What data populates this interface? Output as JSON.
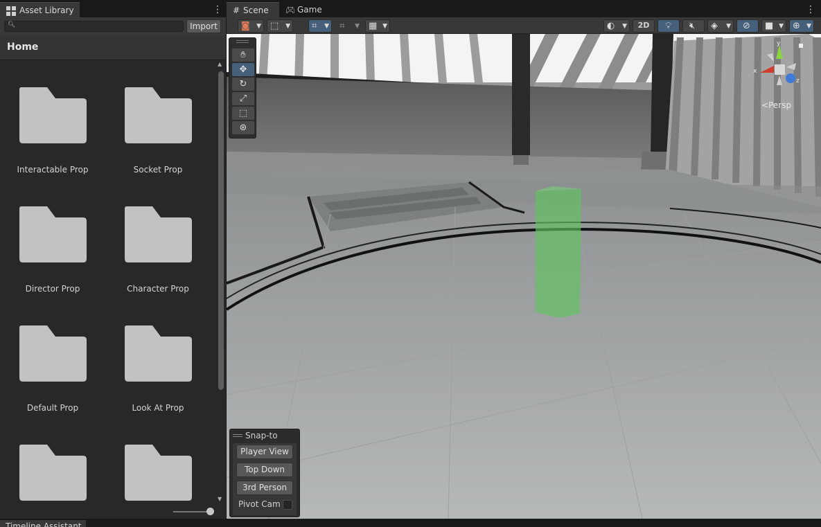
{
  "asset_library": {
    "tab_title": "Asset Library",
    "search": {
      "value": "",
      "placeholder": ""
    },
    "import_label": "Import",
    "heading": "Home",
    "items": [
      {
        "label": "Interactable Prop",
        "icon": "folder-icon"
      },
      {
        "label": "Socket Prop",
        "icon": "folder-icon"
      },
      {
        "label": "Director Prop",
        "icon": "folder-icon"
      },
      {
        "label": "Character Prop",
        "icon": "folder-icon"
      },
      {
        "label": "Default Prop",
        "icon": "folder-icon"
      },
      {
        "label": "Look At Prop",
        "icon": "folder-icon"
      },
      {
        "label": "",
        "icon": "folder-icon"
      },
      {
        "label": "",
        "icon": "folder-icon"
      }
    ],
    "zoom_level": 0.9
  },
  "scene_window": {
    "tabs": [
      {
        "label": "Scene",
        "icon": "grid-icon",
        "active": true
      },
      {
        "label": "Game",
        "icon": "gamepad-icon",
        "active": false
      }
    ],
    "toolbar": {
      "two_d_label": "2D"
    },
    "tools": [
      {
        "name": "hand-tool",
        "icon": "hand-icon",
        "active": false
      },
      {
        "name": "move-tool",
        "icon": "move-icon",
        "active": true
      },
      {
        "name": "rotate-tool",
        "icon": "rotate-icon",
        "active": false
      },
      {
        "name": "scale-tool",
        "icon": "scale-icon",
        "active": false
      },
      {
        "name": "rect-tool",
        "icon": "rect-icon",
        "active": false
      },
      {
        "name": "transform-tool",
        "icon": "transform-icon",
        "active": false
      }
    ],
    "orientation_gizmo": {
      "label": "Persp",
      "axes": {
        "y": "y",
        "x": "x",
        "z": "z"
      }
    },
    "snap_overlay": {
      "title": "Snap-to",
      "buttons": [
        "Player View",
        "Top Down",
        "3rd Person"
      ],
      "pivot_label": "Pivot Cam",
      "pivot_checked": false
    }
  },
  "bottom_tab": {
    "label": "Timeline Assistant"
  },
  "colors": {
    "accent": "#46607c",
    "trigger_volume": "#5fc45f",
    "panel": "#282828"
  }
}
